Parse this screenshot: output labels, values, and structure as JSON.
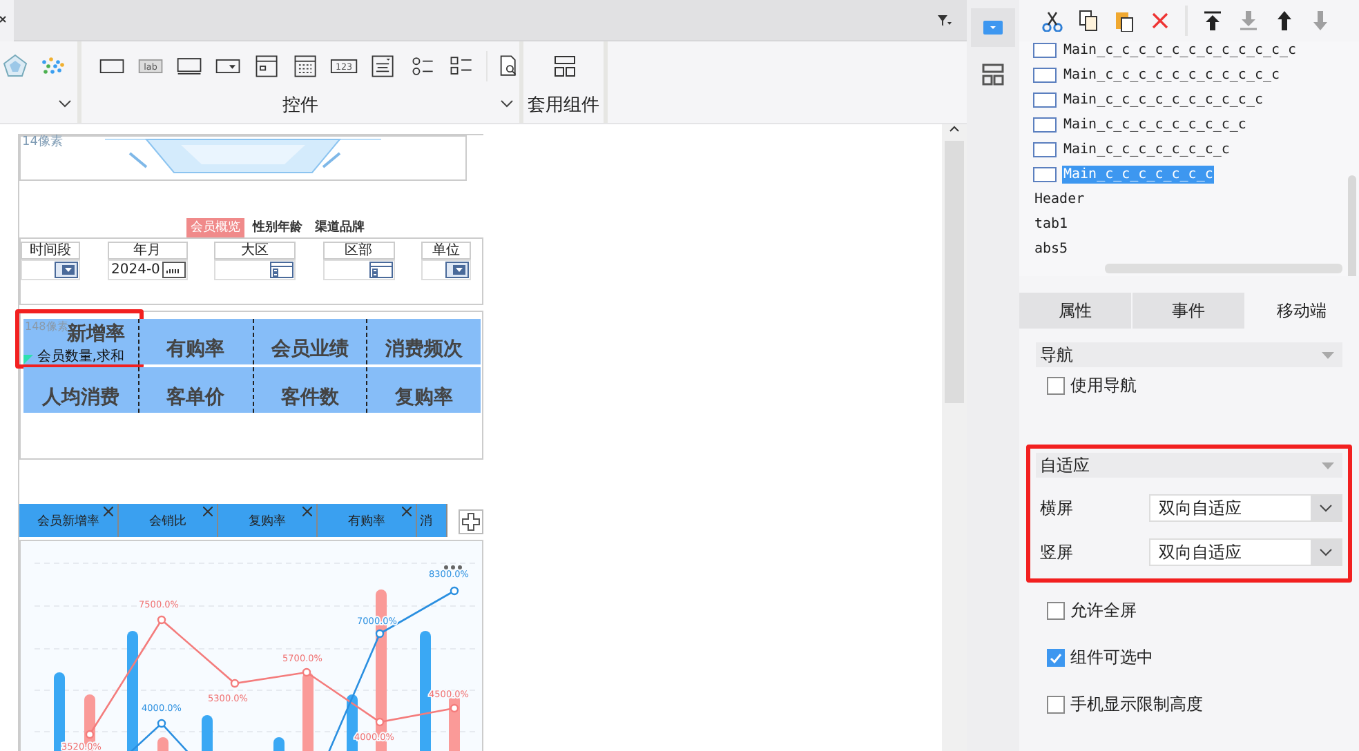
{
  "toolbar": {
    "widgets": [
      {
        "kind": "text-field"
      },
      {
        "kind": "label",
        "text": "lab"
      },
      {
        "kind": "button"
      },
      {
        "kind": "combo"
      },
      {
        "kind": "list-box"
      },
      {
        "kind": "date"
      },
      {
        "kind": "number",
        "text": "123"
      },
      {
        "kind": "text-area"
      },
      {
        "kind": "radio"
      },
      {
        "kind": "checkbox"
      }
    ],
    "widget_group_label": "控件",
    "template_group_label": "套用组件"
  },
  "canvas": {
    "header_size_label": "14像素",
    "nav_tabs": [
      {
        "label": "会员概览",
        "selected": true
      },
      {
        "label": "性别年龄",
        "selected": false
      },
      {
        "label": "渠道品牌",
        "selected": false
      }
    ],
    "filters": [
      {
        "label": "时间段",
        "kind": "dropdown"
      },
      {
        "label": "年月",
        "kind": "date",
        "value": "2024-0"
      },
      {
        "label": "大区",
        "kind": "tree"
      },
      {
        "label": "区部",
        "kind": "tree"
      },
      {
        "label": "单位",
        "kind": "dropdown"
      }
    ],
    "kpi_size_label": "148像素",
    "kpis": [
      {
        "title": "新增率",
        "subtitle": "会员数量,求和",
        "highlighted": true
      },
      {
        "title": "有购率",
        "highlighted": false
      },
      {
        "title": "会员业绩",
        "highlighted": false
      },
      {
        "title": "消费频次",
        "highlighted": false
      },
      {
        "title": "人均消费",
        "highlighted": false
      },
      {
        "title": "客单价",
        "highlighted": false
      },
      {
        "title": "客件数",
        "highlighted": false
      },
      {
        "title": "复购率",
        "highlighted": false
      }
    ],
    "chart_tabs": [
      {
        "label": "会员新增率"
      },
      {
        "label": "会销比"
      },
      {
        "label": "复购率"
      },
      {
        "label": "有购率"
      },
      {
        "label": "消"
      }
    ],
    "chart": {
      "series_labels": [
        [
          "4000.0%",
          "7000.0%",
          "8300.0%"
        ],
        [
          "3520.0%",
          "7500.0%",
          "5300.0%",
          "5700.0%",
          "4000.0%",
          "4500.0%"
        ]
      ]
    }
  },
  "panel": {
    "tools": [
      {
        "kind": "cut",
        "disabled": false
      },
      {
        "kind": "copy",
        "disabled": false
      },
      {
        "kind": "paste",
        "disabled": false
      },
      {
        "kind": "delete",
        "disabled": false
      },
      {
        "kind": "top",
        "disabled": false
      },
      {
        "kind": "bottom",
        "disabled": true
      },
      {
        "kind": "up",
        "disabled": false
      },
      {
        "kind": "down",
        "disabled": true
      }
    ],
    "tree": [
      {
        "label": "Main_c_c_c_c_c_c_c_c_c_c_c_c",
        "kind": "widget",
        "selected": false
      },
      {
        "label": "Main_c_c_c_c_c_c_c_c_c_c_c",
        "kind": "widget",
        "selected": false
      },
      {
        "label": "Main_c_c_c_c_c_c_c_c_c_c",
        "kind": "widget",
        "selected": false
      },
      {
        "label": "Main_c_c_c_c_c_c_c_c_c",
        "kind": "widget",
        "selected": false
      },
      {
        "label": "Main_c_c_c_c_c_c_c_c",
        "kind": "widget",
        "selected": false
      },
      {
        "label": "Main_c_c_c_c_c_c_c",
        "kind": "widget",
        "selected": true
      },
      {
        "label": "Header",
        "kind": "plain",
        "selected": false
      },
      {
        "label": "tab1",
        "kind": "plain",
        "selected": false
      },
      {
        "label": "abs5",
        "kind": "plain",
        "selected": false
      }
    ],
    "tabs": [
      {
        "label": "属性",
        "selected": false
      },
      {
        "label": "事件",
        "selected": false
      },
      {
        "label": "移动端",
        "selected": true
      }
    ],
    "sections": [
      {
        "title": "导航",
        "rows": [
          {
            "kind": "checkbox",
            "label": "使用导航",
            "checked": false
          }
        ]
      },
      {
        "title": "自适应",
        "highlighted": true,
        "rows": [
          {
            "kind": "select",
            "label": "横屏",
            "value": "双向自适应"
          },
          {
            "kind": "select",
            "label": "竖屏",
            "value": "双向自适应"
          }
        ]
      }
    ],
    "options": [
      {
        "label": "允许全屏",
        "checked": false
      },
      {
        "label": "组件可选中",
        "checked": true
      },
      {
        "label": "手机显示限制高度",
        "checked": false
      }
    ]
  }
}
